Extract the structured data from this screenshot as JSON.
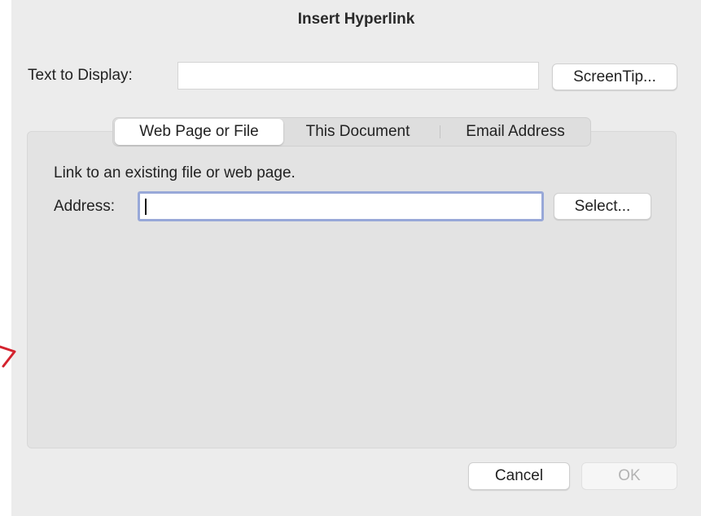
{
  "dialog": {
    "title": "Insert Hyperlink"
  },
  "display_row": {
    "label": "Text to Display:",
    "value": "",
    "screentip_button": "ScreenTip..."
  },
  "tabs": [
    {
      "label": "Web Page or File",
      "selected": true
    },
    {
      "label": "This Document",
      "selected": false
    },
    {
      "label": "Email Address",
      "selected": false
    }
  ],
  "web_page_panel": {
    "description": "Link to an existing file or web page.",
    "address_label": "Address:",
    "address_value": "",
    "select_button": "Select..."
  },
  "footer": {
    "cancel_button": "Cancel",
    "ok_button": "OK",
    "ok_enabled": false
  },
  "colors": {
    "dialog_background": "#ececec",
    "focus_ring": "#98a8d8",
    "annotation_mark": "#d4232e"
  }
}
